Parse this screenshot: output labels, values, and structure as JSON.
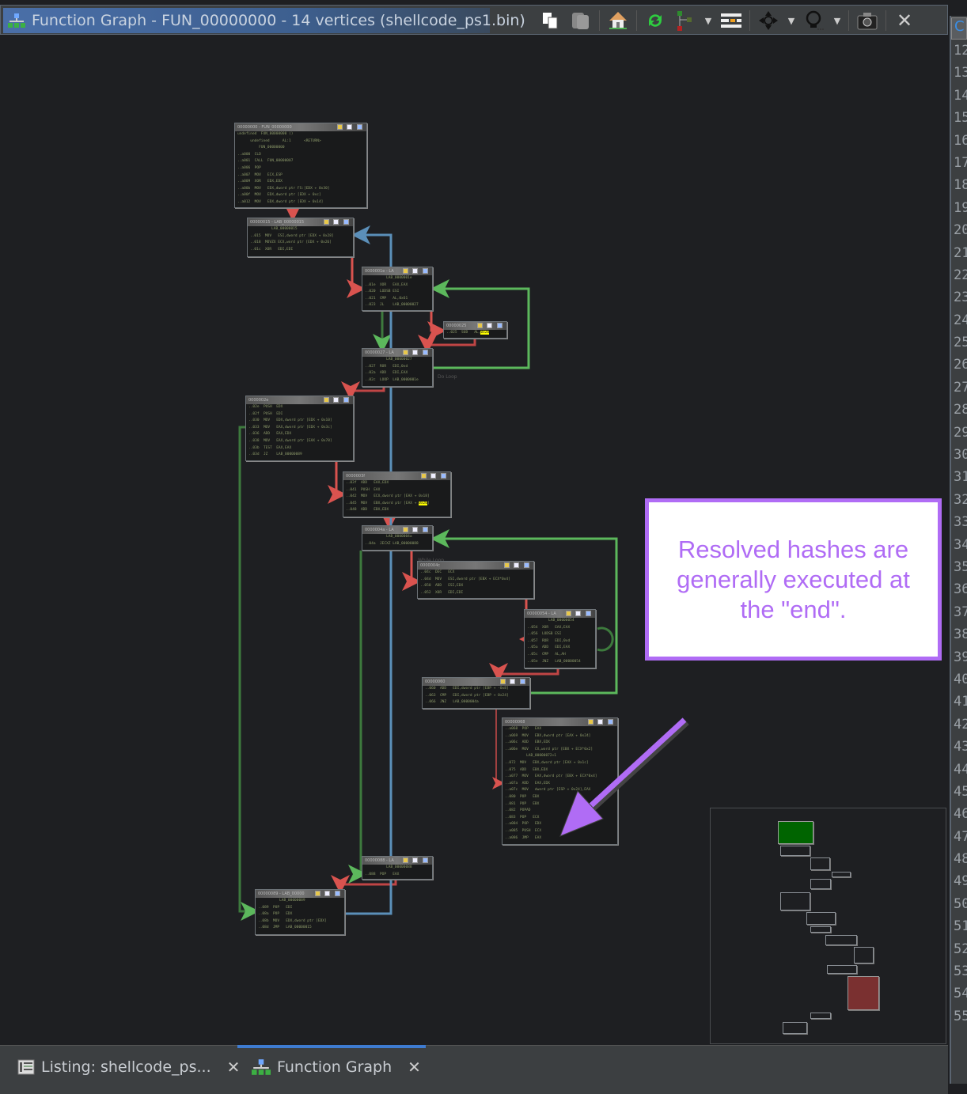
{
  "window": {
    "title": "Function Graph - FUN_00000000 - 14 vertices  (shellcode_ps1.bin)",
    "title_icon": "function-graph-icon"
  },
  "toolbar": {
    "buttons": [
      {
        "name": "copy",
        "icon": "copy-icon"
      },
      {
        "name": "paste",
        "icon": "paste-icon"
      },
      {
        "name": "go-to-function-entry",
        "icon": "home-icon"
      },
      {
        "name": "refresh",
        "icon": "refresh-icon"
      },
      {
        "name": "layout",
        "icon": "layout-icon"
      },
      {
        "name": "edit-fields",
        "icon": "fields-icon"
      },
      {
        "name": "block-hover-mode",
        "icon": "navigation-icon"
      },
      {
        "name": "vertex-focus",
        "icon": "lightbulb-icon"
      },
      {
        "name": "snapshot",
        "icon": "camera-icon"
      },
      {
        "name": "close",
        "icon": "close-icon",
        "glyph": "✕"
      }
    ]
  },
  "blocks": [
    {
      "title": "00000000 - FUN_00000000",
      "lines": [
        "undefined  FUN_00000000 ()",
        "      undefined      AL:1      <RETURN>",
        "          FUN_00000000",
        "..a000  CLD",
        "..a001  CALL  FUN_00000007",
        "..a006  POP",
        "..a007  MOV   ECX,ESP",
        "..a009  XOR   EDX,EDX",
        "..a00b  MOV   EDX,dword ptr FS:[EDX + 0x30]",
        "..a00f  MOV   EDX,dword ptr [EDX + 0xc]",
        "..a012  MOV   EDX,dword ptr [EDX + 0x14]"
      ]
    },
    {
      "title": "00000015 - LAB_00000015",
      "lines": [
        "          LAB_00000015",
        "..015  MOV   ESI,dword ptr [EDX + 0x28]",
        "..018  MOVZX ECX,word ptr [EDX + 0x26]",
        "..01c  XOR   EDI,EDI"
      ]
    },
    {
      "title": "0000001e - LA",
      "lines": [
        "          LAB_0000001e",
        "..01e  XOR   EAX,EAX",
        "..020  LODSB ESI",
        "..021  CMP   AL,0x61",
        "..023  JL    LAB_00000027"
      ]
    },
    {
      "title": "00000025",
      "lines": [
        "..025  SUB   AL,0x20"
      ],
      "highlight": "0x20"
    },
    {
      "title": "00000027 - LA",
      "lines": [
        "          LAB_00000027",
        "..027  ROR   EDI,0xd",
        "..02a  ADD   EDI,EAX",
        "..02c  LOOP  LAB_0000001e"
      ]
    },
    {
      "title": "0000002e",
      "lines": [
        "..02e  PUSH  EDX",
        "..02f  PUSH  EDI",
        "..030  MOV   EDX,dword ptr [EDX + 0x10]",
        "..033  MOV   EAX,dword ptr [EDX + 0x3c]",
        "..036  ADD   EAX,EDX",
        "..038  MOV   EAX,dword ptr [EAX + 0x78]",
        "..03b  TEST  EAX,EAX",
        "..03d  JZ    LAB_00000089"
      ]
    },
    {
      "title": "0000003f",
      "lines": [
        "..03f  ADD   EAX,EDX",
        "..041  PUSH  EAX",
        "..042  MOV   ECX,dword ptr [EAX + 0x18]",
        "..045  MOV   EBX,dword ptr [EAX + 0x20]",
        "..048  ADD   EBX,EDX"
      ],
      "highlight": "0x20"
    },
    {
      "title": "0000004a - LA",
      "lines": [
        "          LAB_0000004a",
        "..04a  JECXZ LAB_00000088"
      ]
    },
    {
      "title": "0000004c",
      "lines": [
        "..04c  DEC   ECX",
        "..04d  MOV   ESI,dword ptr [EBX + ECX*0x4]",
        "..050  ADD   ESI,EDX",
        "..052  XOR   EDI,EDI"
      ]
    },
    {
      "title": "00000054 - LA",
      "lines": [
        "          LAB_00000054",
        "..054  XOR   EAX,EAX",
        "..056  LODSB ESI",
        "..057  ROR   EDI,0xd",
        "..05a  ADD   EDI,EAX",
        "..05c  CMP   AL,AH",
        "..05e  JNZ   LAB_00000054"
      ]
    },
    {
      "title": "00000060",
      "lines": [
        "..060  ADD   EDI,dword ptr [EBP + -0x8]",
        "..063  CMP   EDI,dword ptr [EBP + 0x24]",
        "..066  JNZ   LAB_0000004a"
      ]
    },
    {
      "title": "00000068",
      "lines": [
        "..a068  POP   EAX",
        "..a069  MOV   EBX,dword ptr [EAX + 0x24]",
        "..a06c  ADD   EBX,EDX",
        "..a06e  MOV   CX,word ptr [EBX + ECX*0x2]",
        "          LAB_00000072+1",
        "..072  MOV   EBX,dword ptr [EAX + 0x1c]",
        "..075  ADD   EBX,EDX",
        "..a077  MOV   EAX,dword ptr [EBX + ECX*0x4]",
        "..a07a  ADD   EAX,EDX",
        "..a07c  MOV   dword ptr [ESP + 0x24],EAX",
        "..080  POP   EBX",
        "..081  POP   EBX",
        "..082  POPAD",
        "..083  POP   ECX",
        "..a084  POP   EDX",
        "..a085  PUSH  ECX",
        "..a086  JMP   EAX"
      ]
    },
    {
      "title": "00000088 - LA",
      "lines": [
        "          LAB_00000088",
        "..088  POP   EAX"
      ]
    },
    {
      "title": "00000089 - LAB_00000",
      "lines": [
        "          LAB_00000089",
        "..089  POP   EDI",
        "..08a  POP   EDX",
        "..08b  MOV   EDX,dword ptr [EDX]",
        "..08d  JMP   LAB_00000015"
      ]
    }
  ],
  "edge_labels": {
    "do_loop": "Do Loop",
    "while_loop": "While Loop"
  },
  "annotation": {
    "text": "Resolved hashes are generally executed at the \"end\".",
    "color": "#b06cf5"
  },
  "satellite_view": {
    "entry_color": "#006400",
    "exit_color": "#7a3030"
  },
  "side_panel": {
    "line_numbers": [
      "12",
      "13",
      "14",
      "15",
      "16",
      "17",
      "18",
      "19",
      "20",
      "21",
      "22",
      "23",
      "24",
      "25",
      "26",
      "27",
      "28",
      "29",
      "30",
      "31",
      "32",
      "33",
      "34",
      "35",
      "36",
      "37",
      "38",
      "39",
      "40",
      "41",
      "42",
      "43",
      "44",
      "45",
      "46",
      "47",
      "48",
      "49",
      "50",
      "51",
      "52",
      "53",
      "54",
      "55"
    ]
  },
  "bottom_tabs": [
    {
      "label": "Listing:  shellcode_ps...",
      "icon": "listing-icon",
      "close": "✕",
      "active": false
    },
    {
      "label": "Function Graph",
      "icon": "function-graph-icon",
      "close": "✕",
      "active": true
    }
  ],
  "colors": {
    "true_edge": "#5cb85c",
    "false_edge": "#d9534f",
    "unconditional_edge": "#5b8fb9",
    "highlight": "#ffff00"
  }
}
